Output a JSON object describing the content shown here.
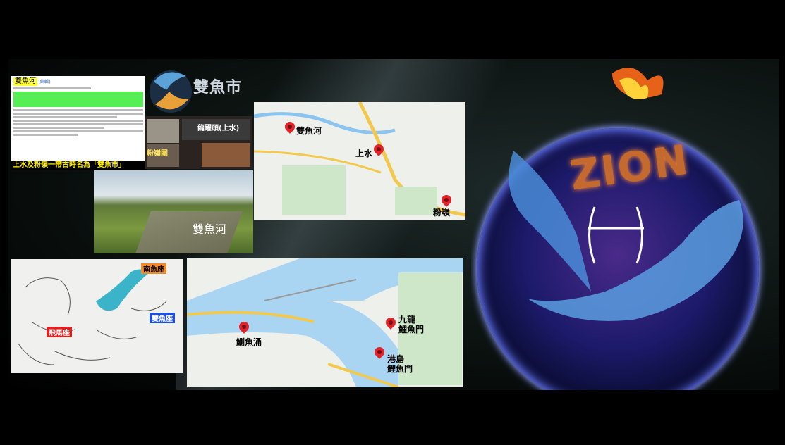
{
  "wiki": {
    "title": "雙魚河",
    "edit_link": "[編輯]",
    "caption": "上水及粉嶺一帶古時名為「雙魚市」"
  },
  "logo": {
    "text": "雙魚市"
  },
  "collage": {
    "label_top": "龍躍頭(上水)",
    "label_bottom": "粉嶺圍"
  },
  "river_photo": {
    "label": "雙魚河"
  },
  "map_top": {
    "pins": [
      "雙魚河",
      "上水",
      "粉嶺"
    ]
  },
  "map_bottom": {
    "pins": [
      "鰂魚涌",
      "九龍\n鯉魚門",
      "港島\n鯉魚門"
    ]
  },
  "star_chart": {
    "labels": [
      "南魚座",
      "雙魚座",
      "飛馬座"
    ]
  },
  "zion": {
    "word": "ZION",
    "colors": {
      "accent": "#e8762e",
      "glow": "#6a7aff"
    }
  }
}
